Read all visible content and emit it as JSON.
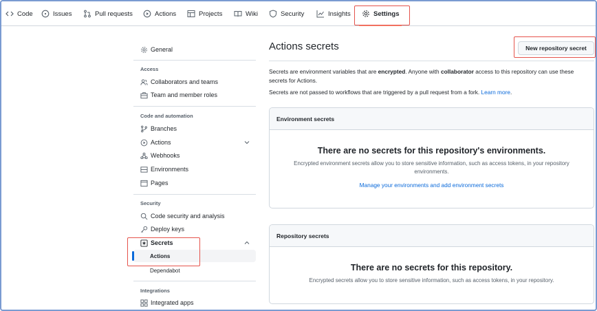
{
  "nav": {
    "tabs": [
      {
        "label": "Code",
        "icon": "code-icon"
      },
      {
        "label": "Issues",
        "icon": "issue-icon"
      },
      {
        "label": "Pull requests",
        "icon": "pull-request-icon"
      },
      {
        "label": "Actions",
        "icon": "play-icon"
      },
      {
        "label": "Projects",
        "icon": "table-icon"
      },
      {
        "label": "Wiki",
        "icon": "book-icon"
      },
      {
        "label": "Security",
        "icon": "shield-icon"
      },
      {
        "label": "Insights",
        "icon": "graph-icon"
      },
      {
        "label": "Settings",
        "icon": "gear-icon",
        "active": true
      }
    ]
  },
  "sidebar": {
    "general": "General",
    "access_heading": "Access",
    "collaborators": "Collaborators and teams",
    "moderation": "Team and member roles",
    "code_heading": "Code and automation",
    "branches": "Branches",
    "actions": "Actions",
    "webhooks": "Webhooks",
    "environments": "Environments",
    "pages": "Pages",
    "security_heading": "Security",
    "code_security": "Code security and analysis",
    "deploy_keys": "Deploy keys",
    "secrets": "Secrets",
    "secrets_actions": "Actions",
    "secrets_dependabot": "Dependabot",
    "integrations_heading": "Integrations",
    "integrated_apps": "Integrated apps"
  },
  "main": {
    "title": "Actions secrets",
    "new_button": "New repository secret",
    "desc1_a": "Secrets are environment variables that are ",
    "desc1_b": "encrypted",
    "desc1_c": ". Anyone with ",
    "desc1_d": "collaborator",
    "desc1_e": " access to this repository can use these secrets for Actions.",
    "desc2_a": "Secrets are not passed to workflows that are triggered by a pull request from a fork. ",
    "desc2_link": "Learn more",
    "desc2_end": ".",
    "env_box": {
      "header": "Environment secrets",
      "title": "There are no secrets for this repository's environments.",
      "text": "Encrypted environment secrets allow you to store sensitive information, such as access tokens, in your repository environments.",
      "link": "Manage your environments and add environment secrets"
    },
    "repo_box": {
      "header": "Repository secrets",
      "title": "There are no secrets for this repository.",
      "text": "Encrypted secrets allow you to store sensitive information, such as access tokens, in your repository."
    }
  },
  "colors": {
    "link": "#0969da",
    "highlight": "#e5534b",
    "active_tab_underline": "#fd8c73"
  }
}
